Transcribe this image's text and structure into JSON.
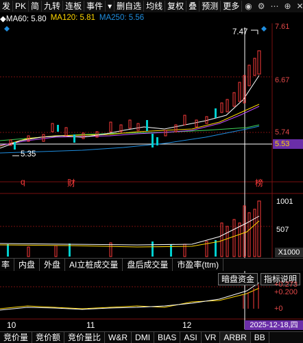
{
  "toolbar": {
    "items": [
      "发",
      "PK",
      "简",
      "九转",
      "连板",
      "事件",
      "▾",
      "删自选",
      "均线",
      "复权",
      "叠",
      "预测",
      "更多"
    ],
    "icons": [
      "eye-icon",
      "gear-icon",
      "more-icon",
      "add-icon",
      "close-icon"
    ]
  },
  "ma": {
    "ma60_label": "MA60: 5.80",
    "ma120_label": "MA120: 5.81",
    "ma250_label": "MA250: 5.56",
    "ma60_color": "#ffffff",
    "ma120_color": "#ffd700",
    "ma250_color": "#1f8ee0"
  },
  "price_axis": {
    "p1": "7.61",
    "p2": "6.67",
    "p3": "5.74",
    "current": "5.53",
    "high_marker": "7.47",
    "low_marker": "5.35"
  },
  "kline_markers": {
    "q": "q",
    "cai": "财",
    "bang": "榜"
  },
  "volume_axis": {
    "v1": "1001",
    "v2": "507",
    "unit": "X1000"
  },
  "tabs": [
    "率",
    "内盘",
    "外盘",
    "AI立桩成交量",
    "盘后成交量",
    "市盈率(ttm)"
  ],
  "buttons": {
    "dark_pool": "暗盘资金",
    "indicator_help": "指标说明"
  },
  "indicator_axis": {
    "a1": "+0.273",
    "a2": "+0.200",
    "a3": "+0"
  },
  "dates": {
    "d10": "10",
    "d11": "11",
    "d12": "12",
    "cursor": "2025-12-18,四"
  },
  "bottom_tabs": [
    "竞价量",
    "竞价额",
    "竞价量比",
    "W&R",
    "DMI",
    "BIAS",
    "ASI",
    "VR",
    "ARBR",
    "BB"
  ],
  "colors": {
    "up": "#ff3b3b",
    "down": "#00d0d0",
    "grid": "#7a1010"
  }
}
